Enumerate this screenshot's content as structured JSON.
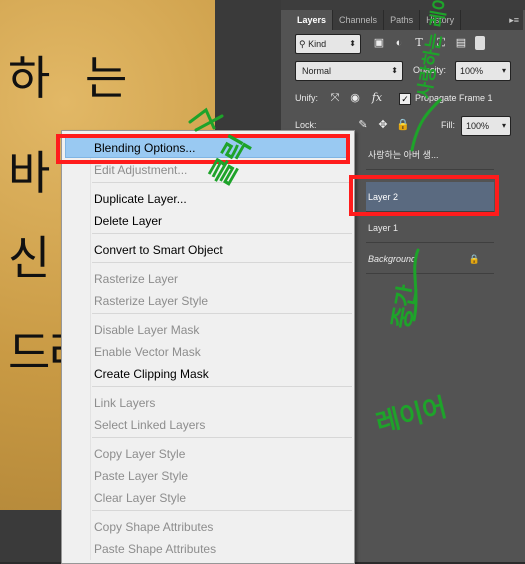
{
  "canvas": {
    "handwriting": [
      "하",
      "는",
      "바",
      "신",
      "드",
      "리"
    ]
  },
  "panel": {
    "tabs": [
      {
        "label": "Layers",
        "active": true
      },
      {
        "label": "Channels",
        "active": false
      },
      {
        "label": "Paths",
        "active": false
      },
      {
        "label": "History",
        "active": false
      }
    ],
    "tab_menu": "▸≡",
    "filter": {
      "kind_label": "Kind",
      "icons": [
        "image-filter-icon",
        "adjustment-filter-icon",
        "type-filter-icon",
        "shape-filter-icon",
        "smart-object-filter-icon"
      ]
    },
    "blend_mode": "Normal",
    "opacity_label": "Opacity:",
    "opacity_value": "100%",
    "unify_label": "Unify:",
    "propagate_label": "Propagate Frame 1",
    "lock_label": "Lock:",
    "fill_label": "Fill:",
    "fill_value": "100%",
    "layers": [
      {
        "name": "사랑하는 아버 생...",
        "selected": false
      },
      {
        "name": "Layer 2",
        "selected": true
      },
      {
        "name": "Layer 1",
        "selected": false
      },
      {
        "name": "Background",
        "selected": false,
        "locked": true
      }
    ]
  },
  "context_menu": {
    "items": [
      {
        "label": "Blending Options...",
        "disabled": false,
        "highlighted": true
      },
      {
        "label": "Edit Adjustment...",
        "disabled": true
      },
      {
        "label": "Duplicate Layer...",
        "disabled": false
      },
      {
        "label": "Delete Layer",
        "disabled": false
      },
      {
        "label": "Convert to Smart Object",
        "disabled": false
      },
      {
        "label": "Rasterize Layer",
        "disabled": true
      },
      {
        "label": "Rasterize Layer Style",
        "disabled": true
      },
      {
        "label": "Disable Layer Mask",
        "disabled": true
      },
      {
        "label": "Enable Vector Mask",
        "disabled": true
      },
      {
        "label": "Create Clipping Mask",
        "disabled": false
      },
      {
        "label": "Link Layers",
        "disabled": true
      },
      {
        "label": "Select Linked Layers",
        "disabled": true
      },
      {
        "label": "Copy Layer Style",
        "disabled": true
      },
      {
        "label": "Paste Layer Style",
        "disabled": true
      },
      {
        "label": "Clear Layer Style",
        "disabled": true
      },
      {
        "label": "Copy Shape Attributes",
        "disabled": true
      },
      {
        "label": "Paste Shape Attributes",
        "disabled": true
      }
    ]
  },
  "annotations": {
    "near_blending": "클릭",
    "near_top_layer": "사랑하는 레이어",
    "below_layers_1": "중간",
    "below_layers_2": "레이어",
    "highlight_color": "#ff1c1c",
    "ink_color": "#1ea32a"
  }
}
